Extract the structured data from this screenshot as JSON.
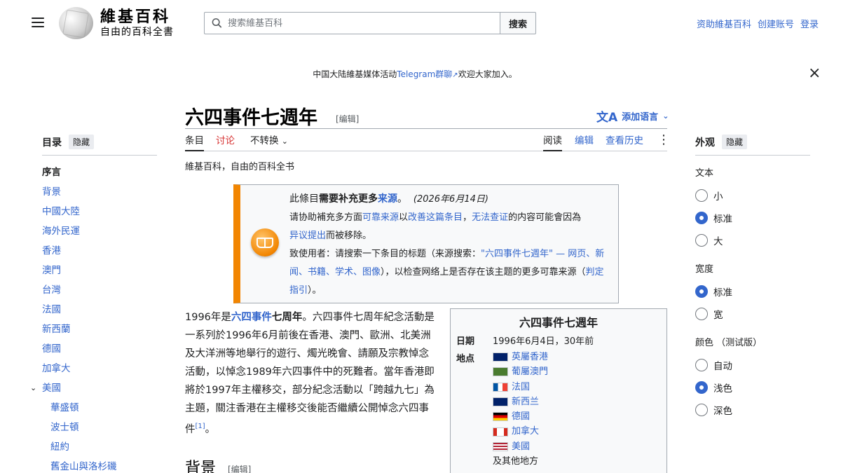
{
  "header": {
    "logo_title": "維基百科",
    "logo_subtitle": "自由的百科全書",
    "search_placeholder": "搜索維基百科",
    "search_button": "搜索",
    "user_links": [
      "资助維基百科",
      "创建账号",
      "登录"
    ]
  },
  "banner": {
    "text_before": "中国大陆維基媒体活动",
    "link": "Telegram群聊",
    "text_after": "欢迎大家加入。",
    "close": "×"
  },
  "toc": {
    "title": "目录",
    "hide": "隐藏",
    "items": [
      "序言",
      "背景",
      "中國大陸",
      "海外民運",
      "香港",
      "澳門",
      "台灣",
      "法國",
      "新西蘭",
      "德國",
      "加拿大",
      "美國",
      "華盛頓",
      "波士頓",
      "紐約",
      "舊金山與洛杉磯"
    ]
  },
  "page": {
    "title": "六四事件七週年",
    "edit": "[编辑]",
    "add_languages": "添加语言",
    "tabs_left": [
      "条目",
      "讨论",
      "不转换"
    ],
    "tabs_right": [
      "阅读",
      "编辑",
      "查看历史"
    ],
    "tagline": "維基百科，自由的百科全书"
  },
  "ambox": {
    "lead_1": "此條目",
    "lead_bold": "需要补充更多",
    "lead_link": "来源",
    "lead_end": "。",
    "date": "(2026年6月14日)",
    "line2_a": "请协助補充多方面",
    "line2_link1": "可靠来源",
    "line2_b": "以",
    "line2_link2": "改善这篇条目",
    "line2_c": "，",
    "line2_link3": "无法查证",
    "line2_d": "的内容可能會因為",
    "line3_link": "异议提出",
    "line3_b": "而被移除。",
    "line4_a": "致使用者：请搜索一下条目的标题（来源搜索：",
    "line4_link": "\"六四事件七週年\" — 网页、新闻、书籍、学术、图像",
    "line4_b": "），以检查网络上是否存在该主题的更多可靠来源（",
    "line4_link2": "判定指引",
    "line4_c": "）。"
  },
  "body": {
    "p1_a": "1996年是",
    "p1_link": "六四事件",
    "p1_bold": "七周年",
    "p1_b": "。六四事件七周年紀念活動是一系列於1996年6月前後在香港、澳門、歐洲、北美洲及大洋洲等地舉行的遊行、燭光晚會、請願及宗教悼念活動，以悼念1989年六四事件中的死難者。當年香港即將於1997年主權移交，部分紀念活動以「跨越九七」為主題，關注香港在主權移交後能否繼續公開悼念六四事件",
    "p1_ref": "[1]",
    "p1_c": "。",
    "section": "背景",
    "section_edit": "[编辑]"
  },
  "infobox": {
    "title": "六四事件七週年",
    "date_label": "日期",
    "date_value": "1996年6月4日，30年前",
    "place_label": "地点",
    "places": [
      "英屬香港",
      "葡屬澳門",
      "法国",
      "新西兰",
      "德國",
      "加拿大",
      "美國"
    ],
    "others": "及其他地方"
  },
  "appearance": {
    "title": "外观",
    "hide": "隐藏",
    "text_label": "文本",
    "text_options": [
      "小",
      "标准",
      "大"
    ],
    "width_label": "宽度",
    "width_options": [
      "标准",
      "宽"
    ],
    "color_label": "颜色 （测试版）",
    "color_options": [
      "自动",
      "浅色",
      "深色"
    ]
  },
  "colors": {
    "link": "#3366cc",
    "ambox_border": "#f28500",
    "red_link": "#d73333"
  }
}
